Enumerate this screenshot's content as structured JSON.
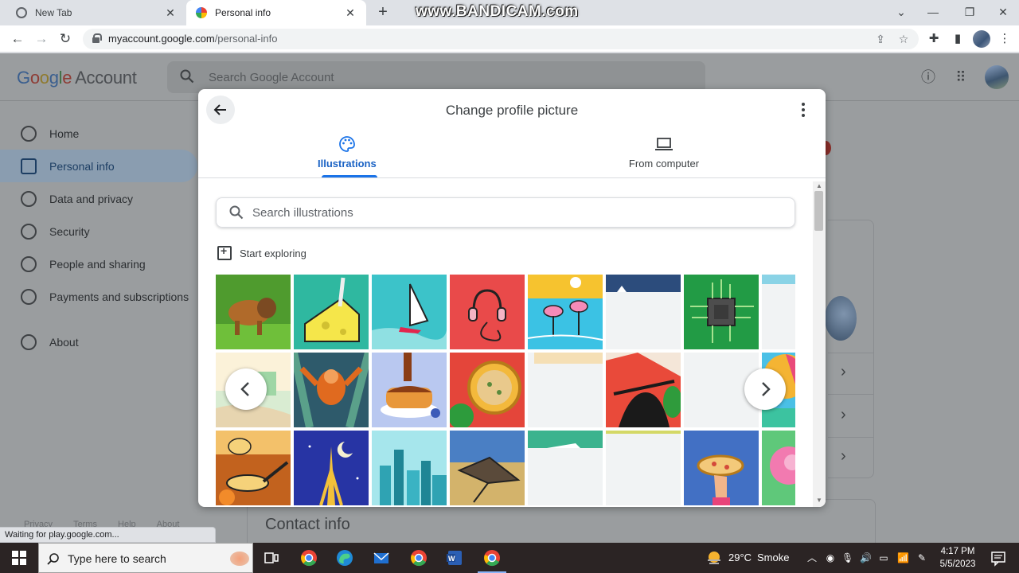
{
  "browser": {
    "tabs": [
      {
        "title": "New Tab",
        "active": false
      },
      {
        "title": "Personal info",
        "active": true
      }
    ],
    "watermark": "www.BANDICAM.com",
    "url_host": "myaccount.google.com",
    "url_path": "/personal-info",
    "status_text": "Waiting for play.google.com..."
  },
  "account_page": {
    "logo": {
      "g1": "G",
      "g2": "o",
      "g3": "o",
      "g4": "g",
      "g5": "l",
      "g6": "e",
      "suffix": "Account"
    },
    "search_placeholder": "Search Google Account",
    "nav": [
      {
        "label": "Home",
        "icon": "home-icon"
      },
      {
        "label": "Personal info",
        "icon": "id-card-icon",
        "active": true
      },
      {
        "label": "Data and privacy",
        "icon": "toggle-icon"
      },
      {
        "label": "Security",
        "icon": "lock-icon"
      },
      {
        "label": "People and sharing",
        "icon": "people-icon"
      },
      {
        "label": "Payments and subscriptions",
        "icon": "card-icon"
      },
      {
        "label": "About",
        "icon": "info-icon"
      }
    ],
    "footer": [
      "Privacy",
      "Terms",
      "Help",
      "About"
    ],
    "contact_heading": "Contact info"
  },
  "dialog": {
    "title": "Change profile picture",
    "tabs": [
      {
        "label": "Illustrations",
        "icon": "palette-icon",
        "active": true
      },
      {
        "label": "From computer",
        "icon": "laptop-icon",
        "active": false
      }
    ],
    "search_placeholder": "Search illustrations",
    "section_label": "Start exploring",
    "colors": {
      "accent": "#1a73e8"
    }
  },
  "taskbar": {
    "search_placeholder": "Type here to search",
    "weather_temp": "29°C",
    "weather_desc": "Smoke",
    "time": "4:17 PM",
    "date": "5/5/2023"
  }
}
